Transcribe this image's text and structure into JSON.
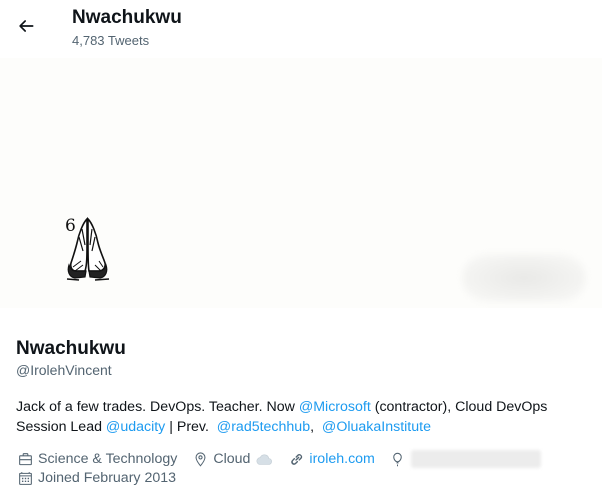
{
  "header": {
    "title": "Nwachukwu",
    "tweet_count": "4,783 Tweets"
  },
  "avatar": {
    "number": "6"
  },
  "profile": {
    "name": "Nwachukwu",
    "handle": "@IrolehVincent",
    "bio": {
      "part1": "Jack of a few trades. DevOps. Teacher. Now ",
      "mention_microsoft": "@Microsoft",
      "part2": " (contractor), Cloud DevOps Session Lead ",
      "mention_udacity": "@udacity",
      "part3": " | Prev.  ",
      "mention_rad5": "@rad5techhub",
      "part4": ",  ",
      "mention_oluaka": "@OluakaInstitute"
    },
    "category": "Science & Technology",
    "location": "Cloud",
    "website": "iroleh.com",
    "joined": "Joined February 2013"
  },
  "colors": {
    "accent": "#1d9bf0",
    "secondary_text": "#536471",
    "primary_text": "#0f1419"
  },
  "icons": {
    "back": "arrow-left-icon",
    "category": "briefcase-icon",
    "location": "location-pin-icon",
    "website": "link-icon",
    "birthday": "balloon-icon",
    "joined": "calendar-icon",
    "cloud": "cloud-emoji-icon"
  }
}
